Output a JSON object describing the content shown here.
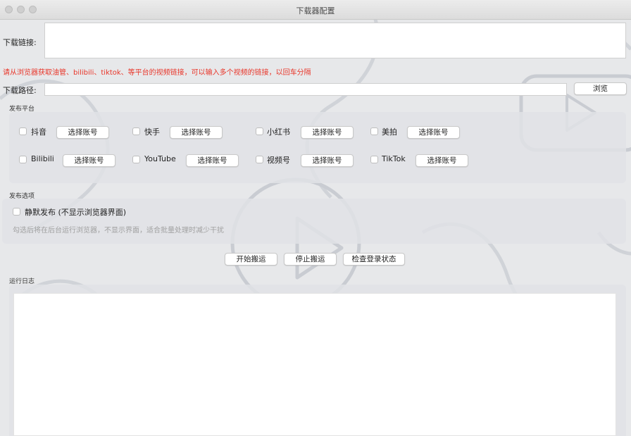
{
  "window": {
    "title": "下载器配置"
  },
  "download_link": {
    "label": "下载链接:",
    "value": ""
  },
  "hint": "请从浏览器获取油管、bilibili、tiktok、等平台的视频链接，可以输入多个视频的链接，以回车分隔",
  "download_path": {
    "label": "下载路径:",
    "value": "",
    "browse_label": "浏览"
  },
  "platforms": {
    "section_label": "发布平台",
    "select_account_label": "选择账号",
    "items": [
      {
        "name": "抖音",
        "checked": false
      },
      {
        "name": "快手",
        "checked": false
      },
      {
        "name": "小红书",
        "checked": false
      },
      {
        "name": "美拍",
        "checked": false
      },
      {
        "name": "Bilibili",
        "checked": false
      },
      {
        "name": "YouTube",
        "checked": false
      },
      {
        "name": "视频号",
        "checked": false
      },
      {
        "name": "TikTok",
        "checked": false
      }
    ]
  },
  "options": {
    "section_label": "发布选项",
    "silent_label": "静默发布 (不显示浏览器界面)",
    "silent_checked": false,
    "silent_hint": "勾选后将在后台运行浏览器，不显示界面，适合批量处理时减少干扰"
  },
  "actions": {
    "start": "开始搬运",
    "stop": "停止搬运",
    "check_login": "检查登录状态"
  },
  "log": {
    "label": "运行日志",
    "content": ""
  }
}
